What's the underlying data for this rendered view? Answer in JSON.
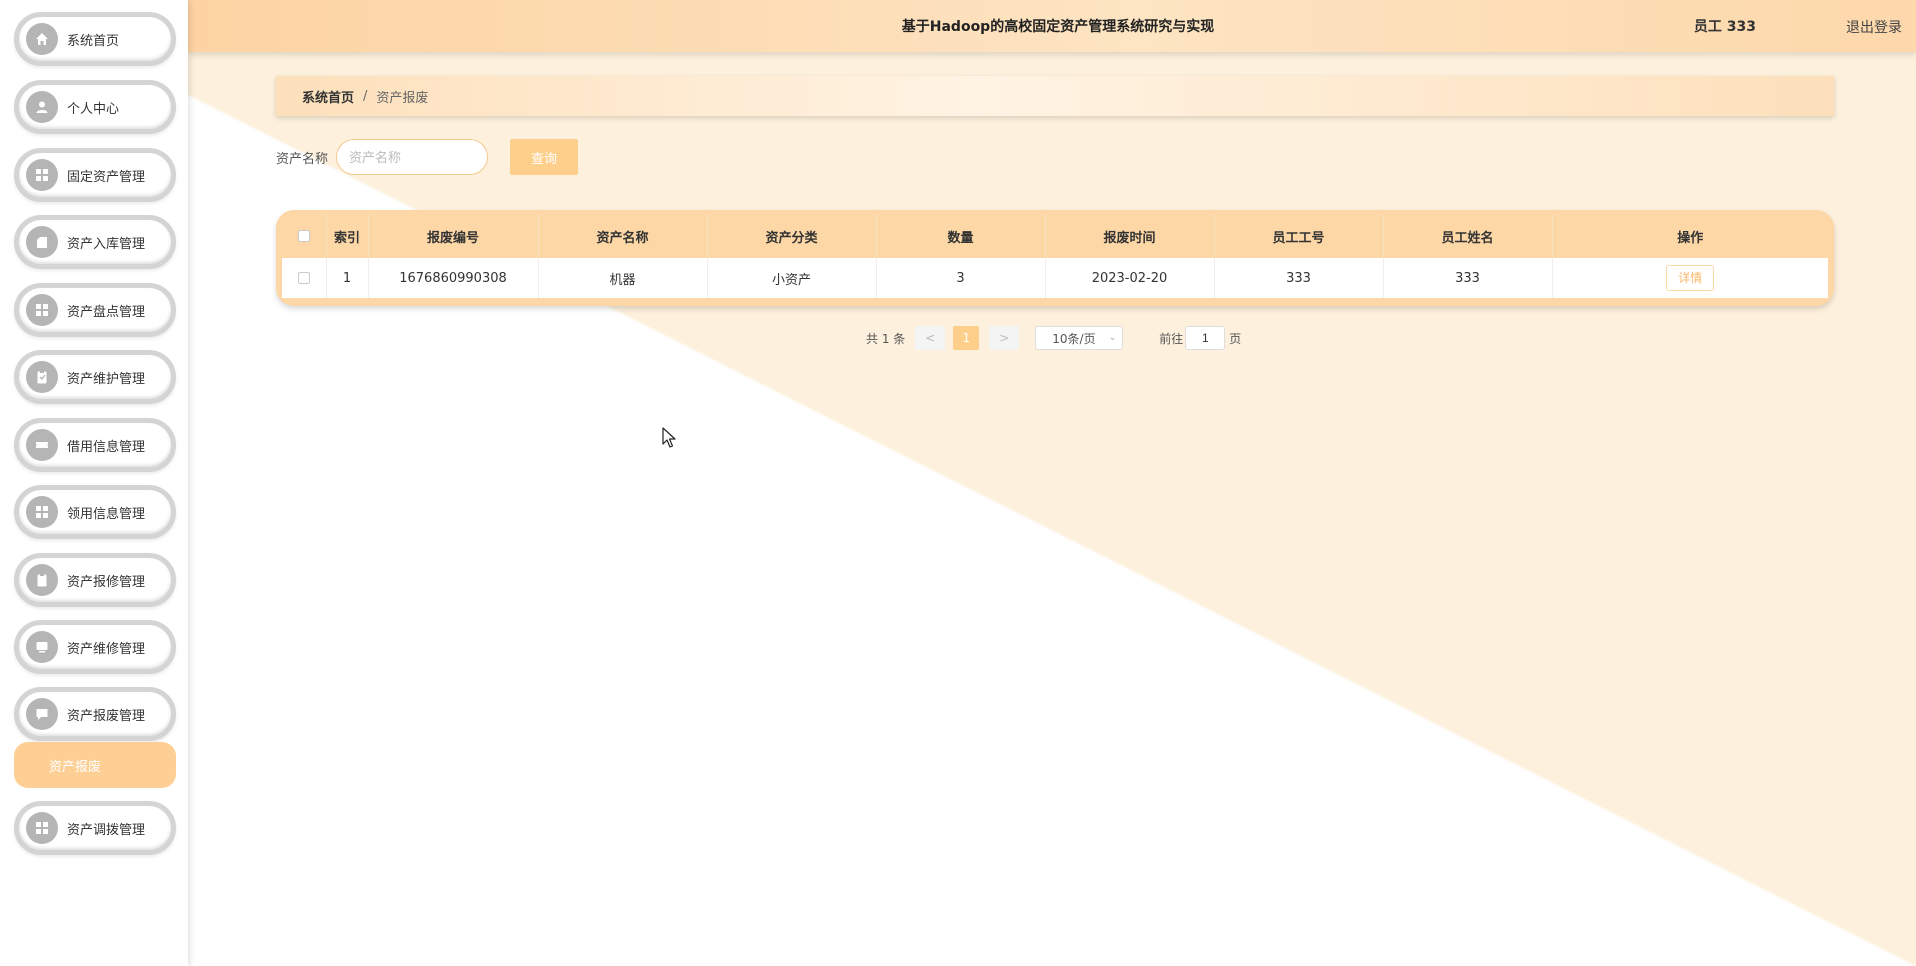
{
  "header": {
    "title": "基于Hadoop的高校固定资产管理系统研究与实现",
    "user": "员工 333",
    "logout": "退出登录"
  },
  "sidebar": {
    "items": [
      {
        "label": "系统首页",
        "icon": "home-icon"
      },
      {
        "label": "个人中心",
        "icon": "user-icon"
      },
      {
        "label": "固定资产管理",
        "icon": "grid-icon"
      },
      {
        "label": "资产入库管理",
        "icon": "box-icon"
      },
      {
        "label": "资产盘点管理",
        "icon": "grid-icon"
      },
      {
        "label": "资产维护管理",
        "icon": "clipboard-icon"
      },
      {
        "label": "借用信息管理",
        "icon": "ticket-icon"
      },
      {
        "label": "领用信息管理",
        "icon": "grid-icon"
      },
      {
        "label": "资产报修管理",
        "icon": "clipboard-icon"
      },
      {
        "label": "资产维修管理",
        "icon": "monitor-icon"
      },
      {
        "label": "资产报废管理",
        "icon": "chat-icon"
      }
    ],
    "active_submenu": "资产报废",
    "last_item": {
      "label": "资产调拨管理",
      "icon": "grid-icon"
    }
  },
  "breadcrumb": {
    "home": "系统首页",
    "separator": "/",
    "current": "资产报废"
  },
  "search": {
    "label": "资产名称",
    "placeholder": "资产名称",
    "button": "查询"
  },
  "table": {
    "headers": [
      "索引",
      "报废编号",
      "资产名称",
      "资产分类",
      "数量",
      "报废时间",
      "员工工号",
      "员工姓名",
      "操作"
    ],
    "rows": [
      {
        "index": "1",
        "code": "1676860990308",
        "name": "机器",
        "category": "小资产",
        "quantity": "3",
        "date": "2023-02-20",
        "emp_no": "333",
        "emp_name": "333",
        "action": "详情"
      }
    ]
  },
  "pagination": {
    "total": "共 1 条",
    "prev": "<",
    "current_page": "1",
    "next": ">",
    "page_size": "10条/页",
    "goto_label": "前往",
    "goto_value": "1",
    "page_suffix": "页"
  },
  "colors": {
    "accent": "#fecf8a",
    "header_bg": "#fdd3a3",
    "table_header": "#fdd7a6",
    "icon_circle": "#b5b5b5"
  }
}
